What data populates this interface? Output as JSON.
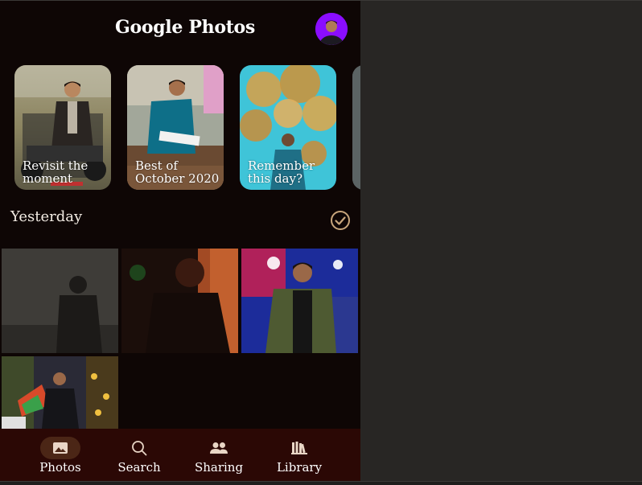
{
  "app": {
    "title": "Google Photos"
  },
  "memories": [
    {
      "label": "Revisit the moment"
    },
    {
      "label": "Best of October 2020"
    },
    {
      "label": "Remember this day?"
    },
    {
      "label": ""
    }
  ],
  "section": {
    "title": "Yesterday"
  },
  "nav": {
    "items": [
      {
        "label": "Photos",
        "icon": "photo-icon",
        "active": true
      },
      {
        "label": "Search",
        "icon": "search-icon",
        "active": false
      },
      {
        "label": "Sharing",
        "icon": "people-icon",
        "active": false
      },
      {
        "label": "Library",
        "icon": "library-icon",
        "active": false
      }
    ]
  },
  "colors": {
    "background": "#0e0605",
    "nav_background": "#2b0805",
    "active_pill": "#4b2616",
    "accent_check": "#c8a67c",
    "avatar_bg": "#8a0dff"
  }
}
